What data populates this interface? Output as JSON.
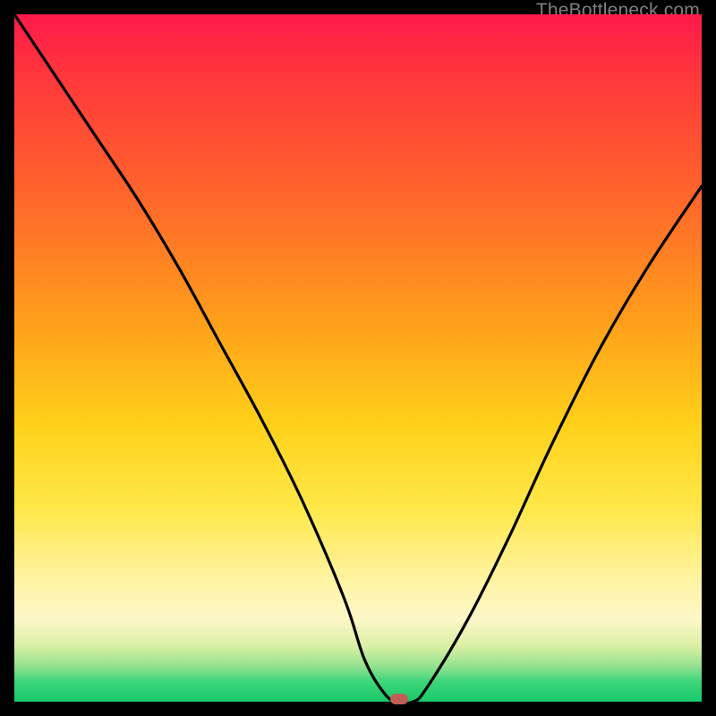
{
  "watermark": "TheBottleneck.com",
  "chart_data": {
    "type": "line",
    "title": "",
    "xlabel": "",
    "ylabel": "",
    "xlim": [
      0,
      100
    ],
    "ylim": [
      0,
      100
    ],
    "grid": false,
    "series": [
      {
        "name": "bottleneck-curve",
        "x": [
          0,
          6,
          12,
          18,
          24,
          30,
          36,
          42,
          48,
          51,
          54,
          56,
          58,
          60,
          66,
          72,
          78,
          85,
          92,
          100
        ],
        "y": [
          100,
          91,
          82,
          73,
          63,
          52,
          41,
          29,
          15,
          6,
          1,
          0,
          0,
          2,
          12,
          24,
          37,
          51,
          63,
          75
        ]
      }
    ],
    "annotations": [
      {
        "name": "optimal-point",
        "x": 56,
        "y": 0,
        "shape": "pill",
        "color": "#c06055"
      }
    ],
    "background": {
      "type": "vertical-gradient",
      "stops": [
        {
          "pos": 0.0,
          "color": "#ff1a4a"
        },
        {
          "pos": 0.5,
          "color": "#ffd21a"
        },
        {
          "pos": 0.88,
          "color": "#fdf7c8"
        },
        {
          "pos": 1.0,
          "color": "#18c96b"
        }
      ]
    }
  }
}
